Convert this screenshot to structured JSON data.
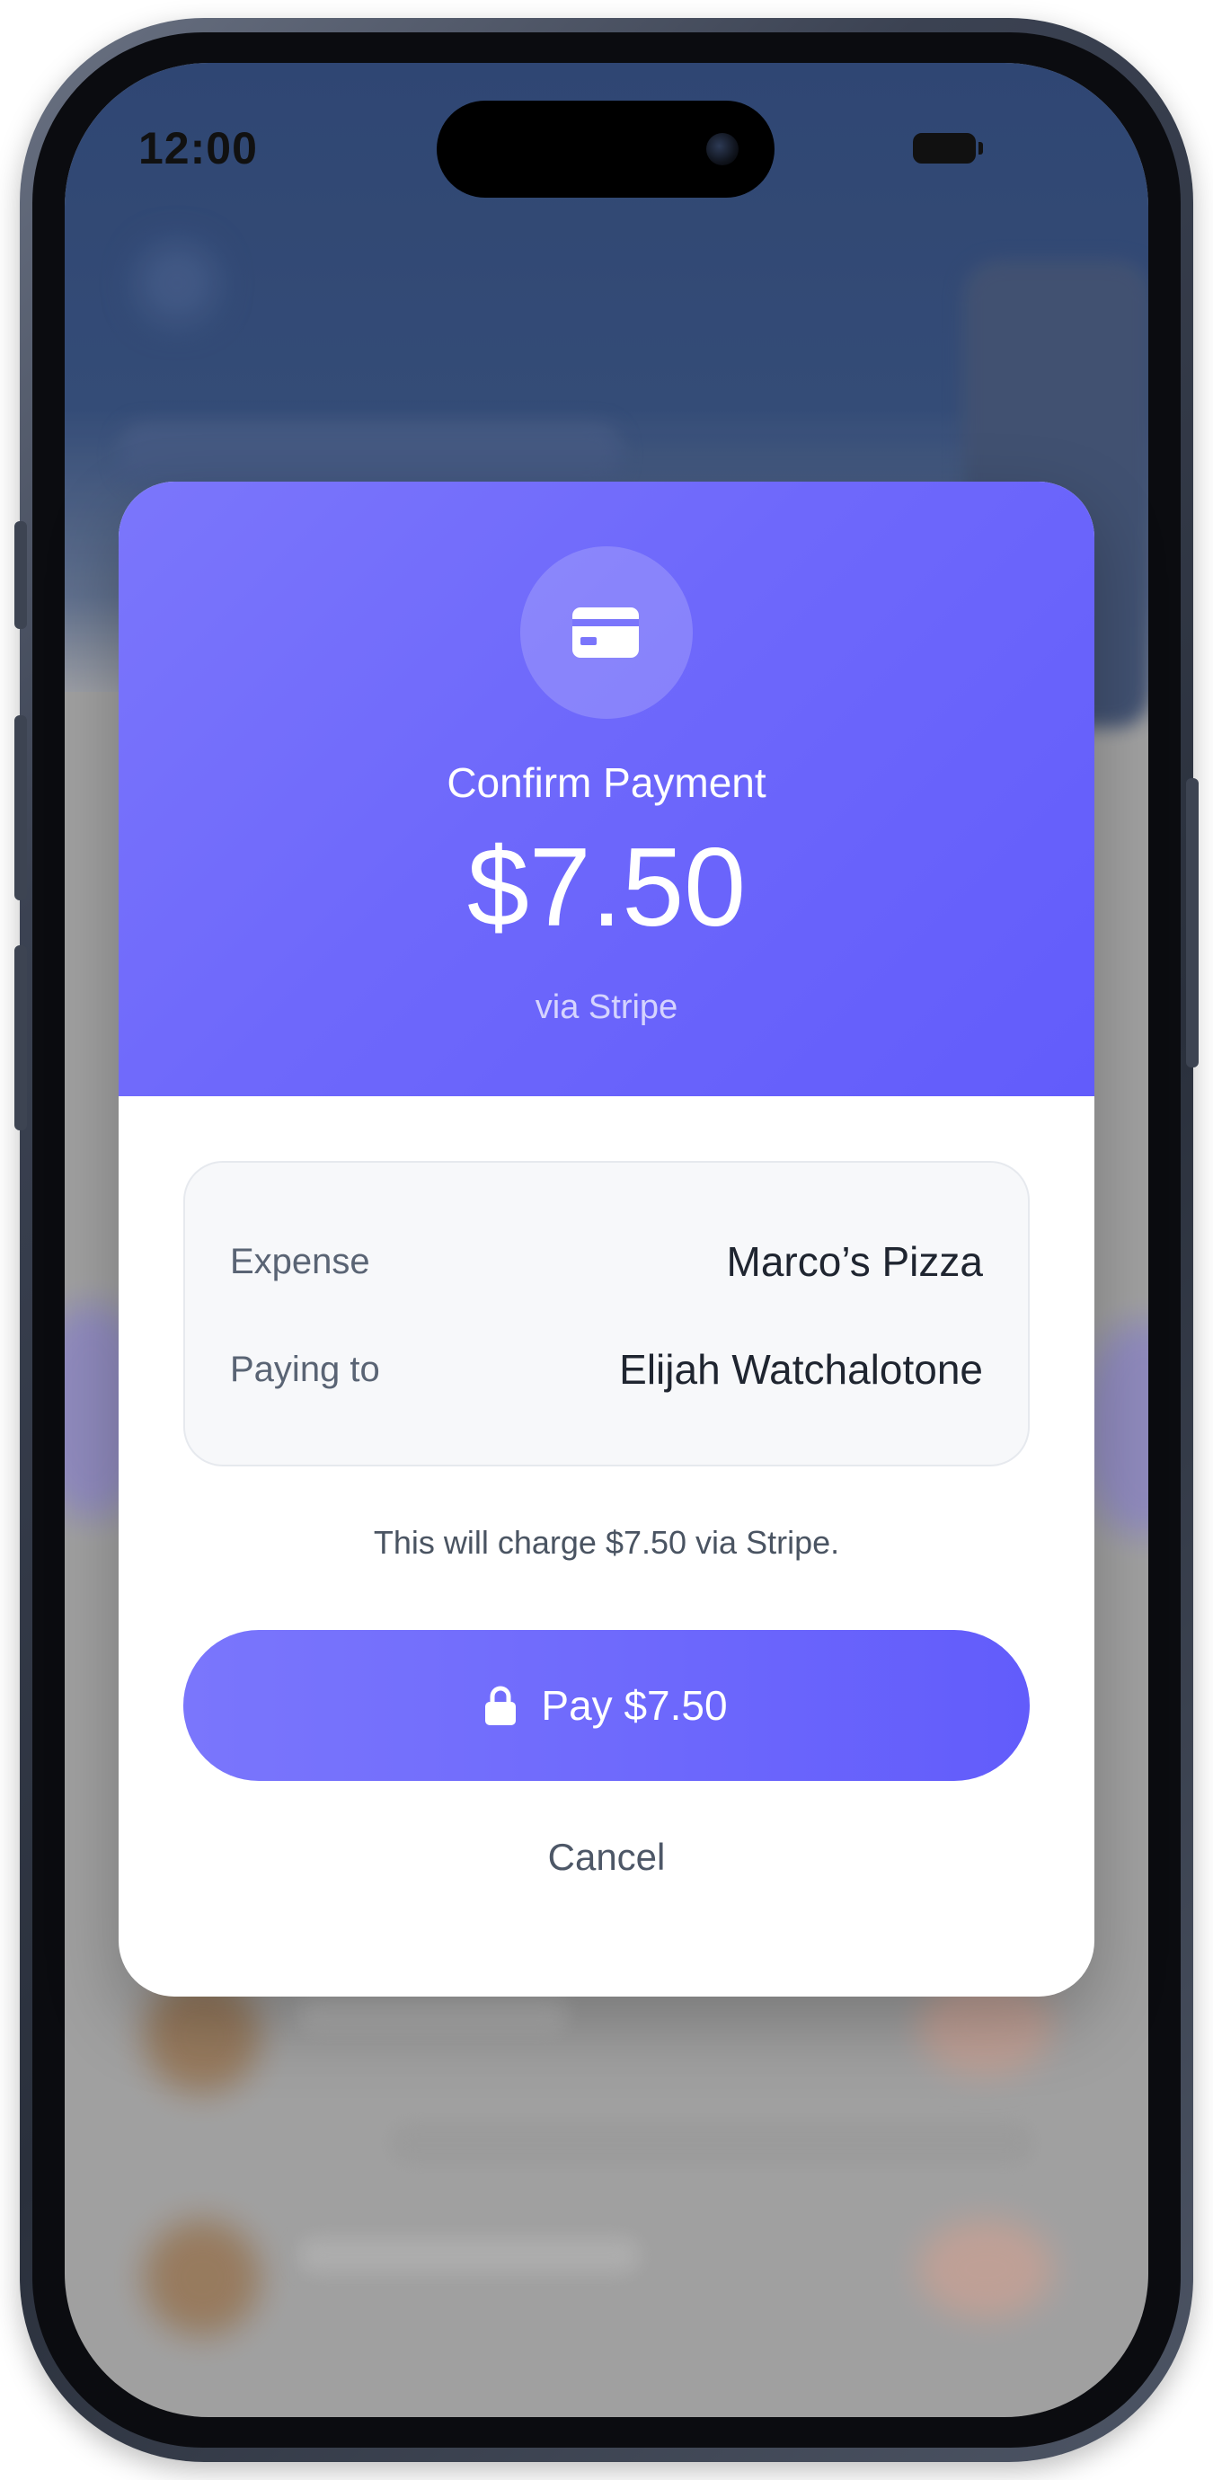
{
  "status_bar": {
    "time": "12:00"
  },
  "payment_modal": {
    "icon": "credit-card-icon",
    "title": "Confirm Payment",
    "amount": "$7.50",
    "provider_line": "via Stripe",
    "details": [
      {
        "label": "Expense",
        "value": "Marco’s Pizza"
      },
      {
        "label": "Paying to",
        "value": "Elijah Watchalotone"
      }
    ],
    "note": "This will charge $7.50 via Stripe.",
    "pay_button": {
      "icon": "lock-icon",
      "label": "Pay $7.50"
    },
    "cancel_label": "Cancel"
  },
  "colors": {
    "accent": "#6c66fb",
    "accent_light": "#7b76fb",
    "background_blue": "#2b4677",
    "text_dark": "#1f2530",
    "text_muted": "#5a6474"
  }
}
